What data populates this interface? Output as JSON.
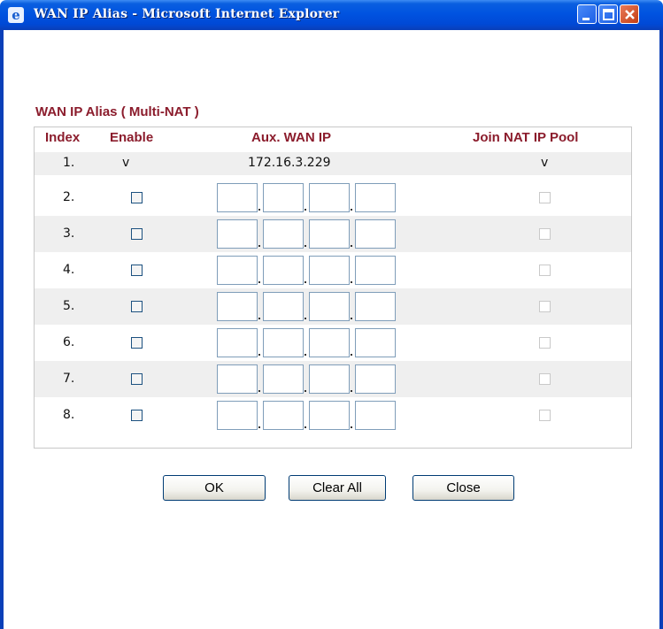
{
  "window": {
    "title": "WAN IP Alias - Microsoft Internet Explorer"
  },
  "form": {
    "heading": "WAN IP Alias ( Multi-NAT )",
    "headers": {
      "index": "Index",
      "enable": "Enable",
      "aux_wan_ip": "Aux. WAN IP",
      "join_nat": "Join NAT IP Pool"
    },
    "row1": {
      "index": "1.",
      "enable": "v",
      "ip": "172.16.3.229",
      "join": "v"
    },
    "rows": [
      {
        "index": "2.",
        "enabled": false,
        "join": false
      },
      {
        "index": "3.",
        "enabled": false,
        "join": false
      },
      {
        "index": "4.",
        "enabled": false,
        "join": false
      },
      {
        "index": "5.",
        "enabled": false,
        "join": false
      },
      {
        "index": "6.",
        "enabled": false,
        "join": false
      },
      {
        "index": "7.",
        "enabled": false,
        "join": false
      },
      {
        "index": "8.",
        "enabled": false,
        "join": false
      }
    ]
  },
  "buttons": {
    "ok": "OK",
    "clear_all": "Clear All",
    "close": "Close"
  }
}
